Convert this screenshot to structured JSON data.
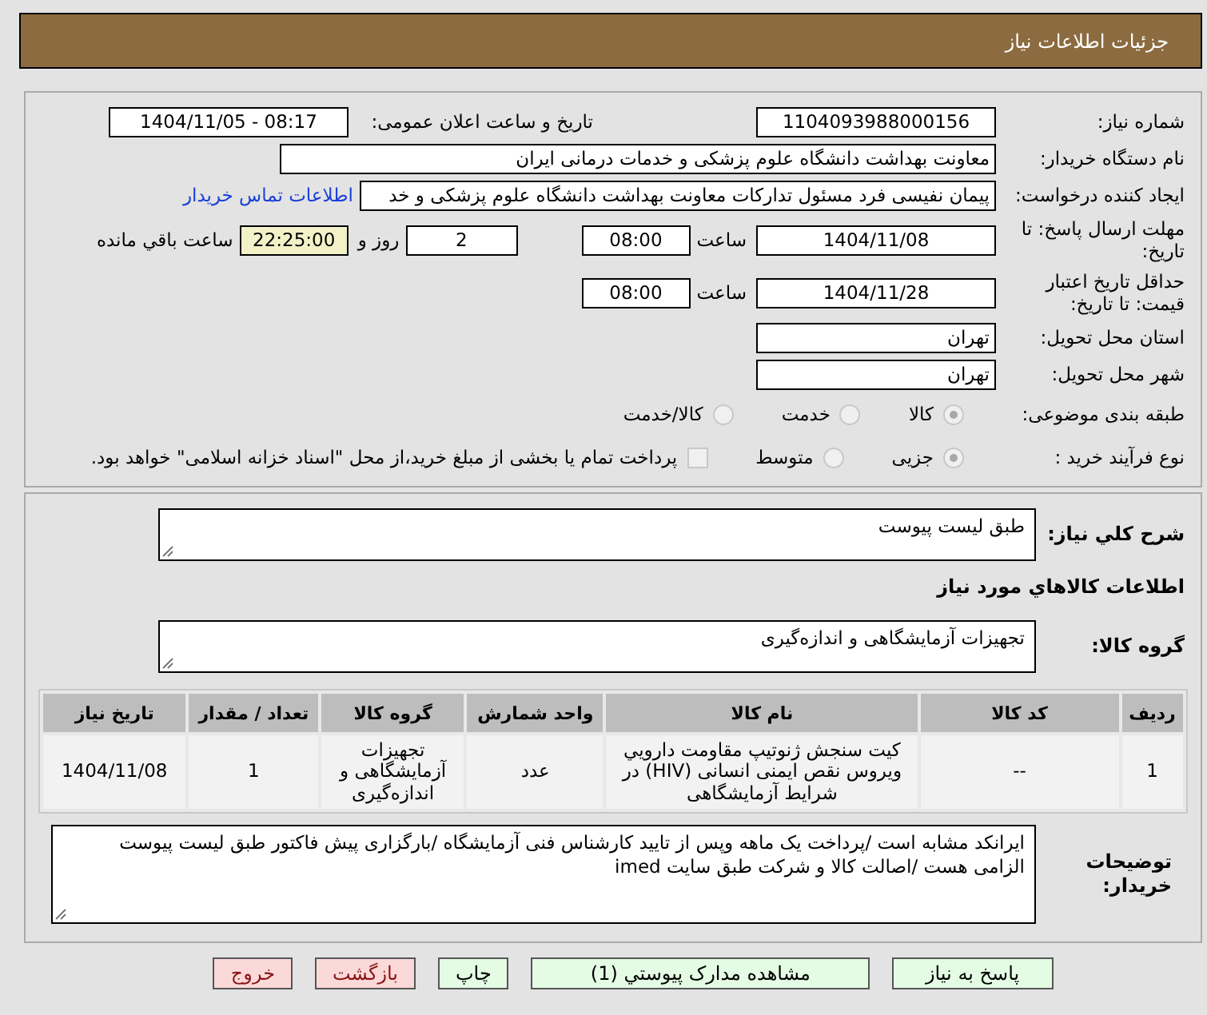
{
  "header": {
    "title": "جزئیات اطلاعات نیاز"
  },
  "details": {
    "need_number": {
      "label": "شماره نیاز:",
      "value": "1104093988000156"
    },
    "announce": {
      "label": "تاریخ و ساعت اعلان عمومی:",
      "value": "1404/11/05 - 08:17"
    },
    "buyer": {
      "label": "نام دستگاه خریدار:",
      "value": "معاونت بهداشت دانشگاه علوم پزشکی و خدمات درمانی ایران"
    },
    "creator": {
      "label": "ایجاد کننده درخواست:",
      "value": "پیمان نفیسی فرد مسئول تدارکات  معاونت بهداشت دانشگاه علوم پزشکی و خد",
      "link": "اطلاعات تماس خریدار"
    },
    "deadline": {
      "label": "مهلت ارسال پاسخ: تا تاریخ:",
      "date": "1404/11/08",
      "time_label": "ساعت",
      "time": "08:00",
      "days": "2",
      "days_label": "روز و",
      "remaining": "22:25:00",
      "remaining_label": "ساعت باقي مانده"
    },
    "validity": {
      "label": "حداقل تاریخ اعتبار قیمت: تا تاریخ:",
      "date": "1404/11/28",
      "time_label": "ساعت",
      "time": "08:00"
    },
    "province": {
      "label": "استان محل تحویل:",
      "value": "تهران"
    },
    "city": {
      "label": "شهر محل تحویل:",
      "value": "تهران"
    },
    "category": {
      "label": "طبقه بندی موضوعی:",
      "options": [
        {
          "label": "کالا",
          "selected": true
        },
        {
          "label": "خدمت",
          "selected": false
        },
        {
          "label": "کالا/خدمت",
          "selected": false
        }
      ]
    },
    "process": {
      "label": "نوع فرآیند خرید :",
      "options": [
        {
          "label": "جزیی",
          "selected": true
        },
        {
          "label": "متوسط",
          "selected": false
        }
      ],
      "payment": {
        "checked": false,
        "label": "پرداخت تمام یا بخشی از مبلغ خرید،از محل \"اسناد خزانه اسلامی\" خواهد بود."
      }
    }
  },
  "items": {
    "description": {
      "label": "شرح کلي نياز:",
      "value": "طبق لیست پیوست"
    },
    "section_title": "اطلاعات کالاهاي مورد نياز",
    "group": {
      "label": "گروه کالا:",
      "value": "تجهیزات آزمایشگاهی و اندازه‌گیری"
    },
    "table": {
      "columns": [
        "ردیف",
        "کد کالا",
        "نام کالا",
        "واحد شمارش",
        "گروه کالا",
        "تعداد / مقدار",
        "تاریخ نیاز"
      ],
      "rows": [
        [
          "1",
          "--",
          "کیت سنجش ژنوتیپ مقاومت دارويي ویروس نقص ایمنی انسانی (HIV) در شرایط آزمایشگاهی",
          "عدد",
          "تجهیزات آزمایشگاهی و اندازه‌گیری",
          "1",
          "1404/11/08"
        ]
      ]
    },
    "notes": {
      "label": "توضیحات خریدار:",
      "value": "ایرانکد مشابه است /پرداخت یک ماهه وپس از تایید کارشناس فنی آزمایشگاه /بارگزاری پیش فاکتور طبق لیست پیوست الزامی هست /اصالت کالا و شرکت طبق سایت imed"
    }
  },
  "buttons": [
    {
      "label": "پاسخ به نیاز",
      "kind": "normal"
    },
    {
      "label": "مشاهده مدارک پیوستي (1)",
      "kind": "normal"
    },
    {
      "label": "چاپ",
      "kind": "normal"
    },
    {
      "label": "بازگشت",
      "kind": "danger"
    },
    {
      "label": "خروج",
      "kind": "danger"
    }
  ]
}
